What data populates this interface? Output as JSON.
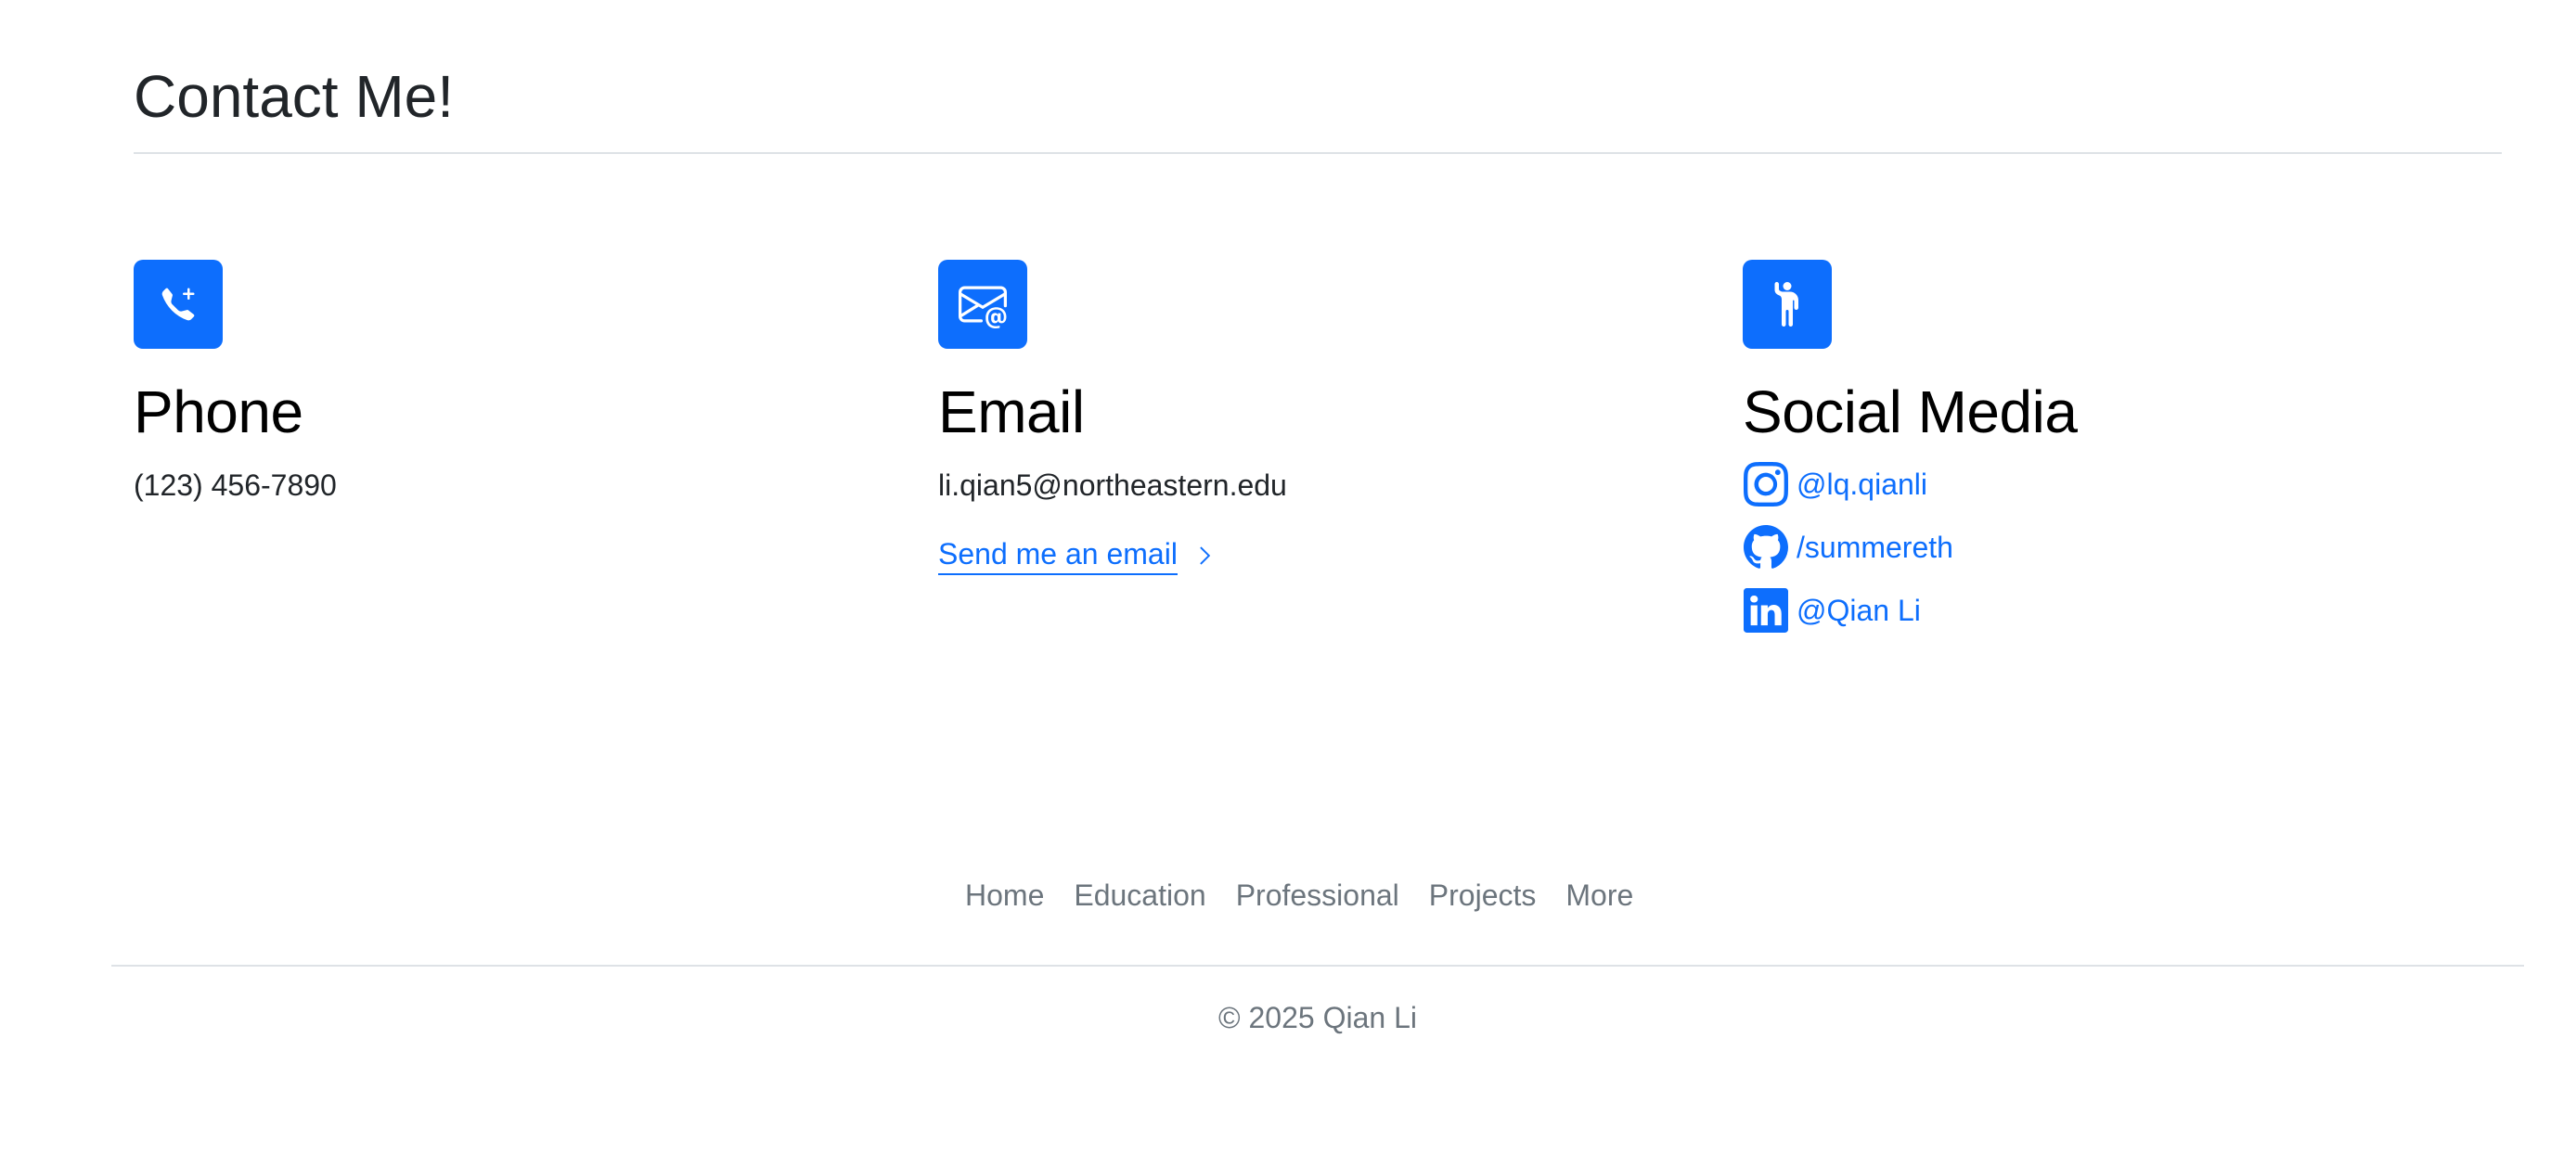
{
  "header": {
    "title": "Contact Me!"
  },
  "phone": {
    "title": "Phone",
    "number": "(123) 456-7890",
    "icon": "telephone-plus-icon"
  },
  "email": {
    "title": "Email",
    "address": "li.qian5@northeastern.edu",
    "link_label": "Send me an email",
    "icon": "envelope-at-icon"
  },
  "social": {
    "title": "Social Media",
    "icon": "person-raised-hand-icon",
    "items": [
      {
        "label": "@lq.qianli",
        "icon": "instagram-icon"
      },
      {
        "label": "/summereth",
        "icon": "github-icon"
      },
      {
        "label": "@Qian Li",
        "icon": "linkedin-icon"
      }
    ]
  },
  "footer": {
    "nav": [
      "Home",
      "Education",
      "Professional",
      "Projects",
      "More"
    ],
    "copyright": "© 2025 Qian Li"
  },
  "colors": {
    "accent": "#0d6efd",
    "muted": "#6c757d",
    "divider": "#dee2e6"
  }
}
